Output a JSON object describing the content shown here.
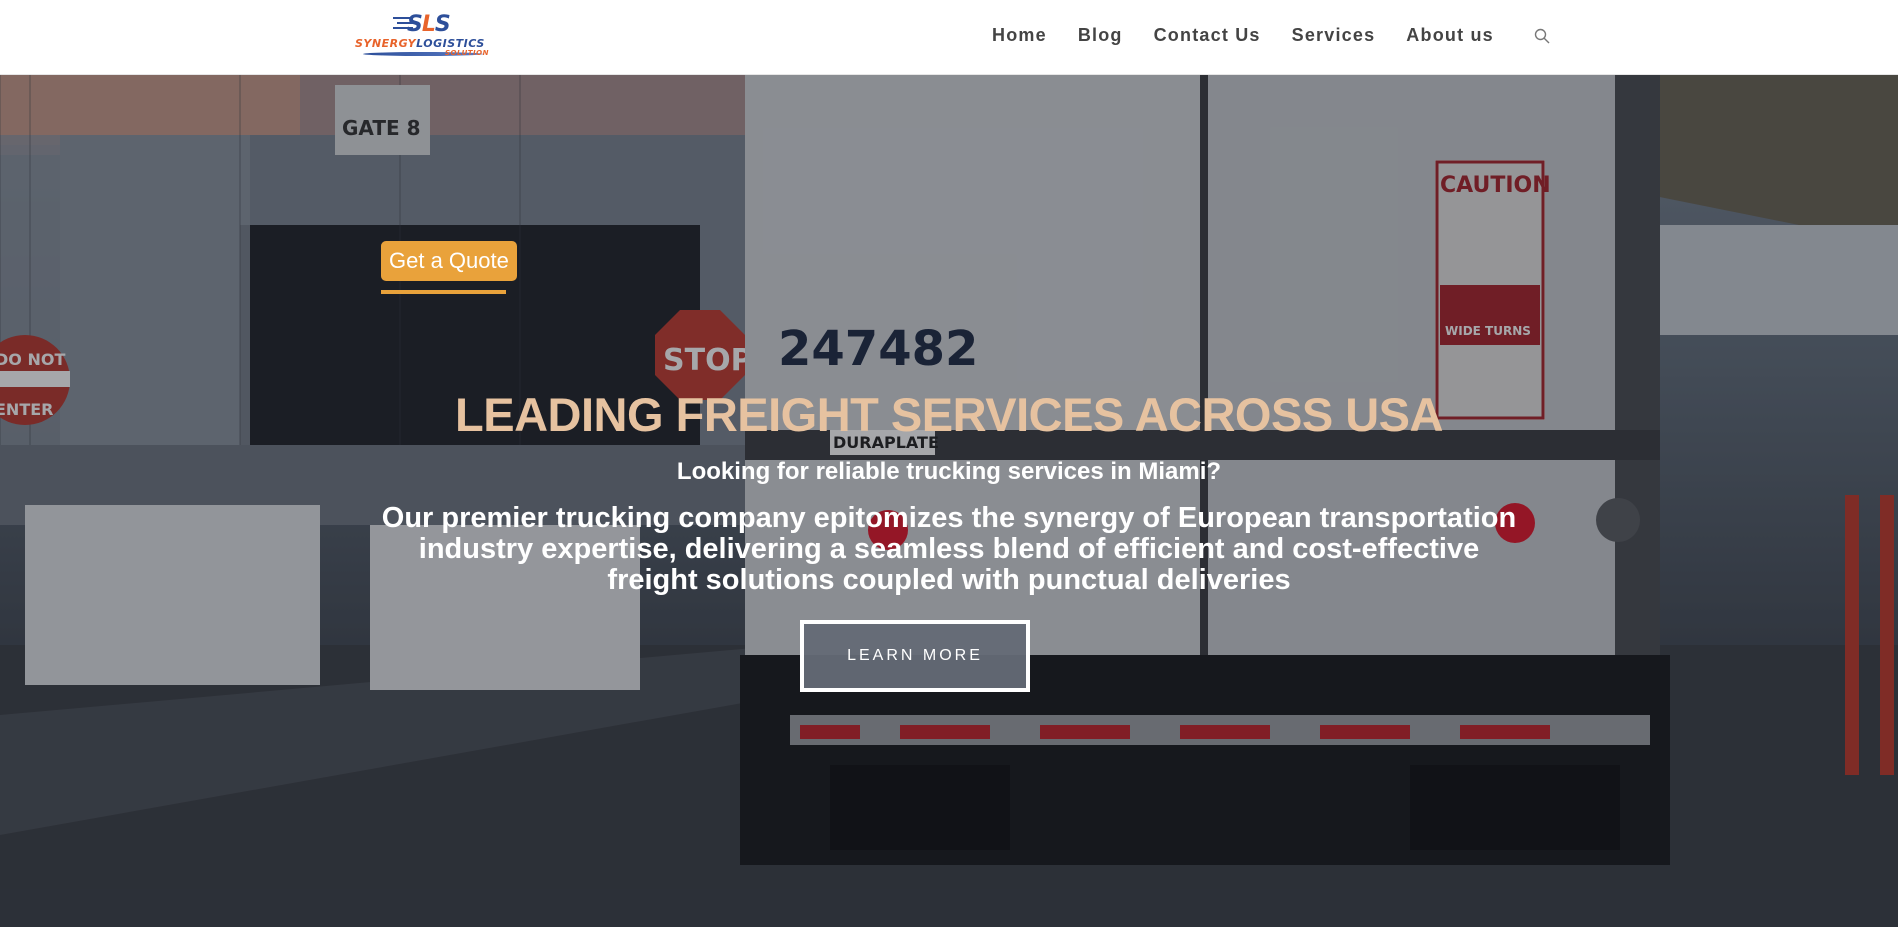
{
  "header": {
    "logo": {
      "mark": "SLS",
      "name_part1": "SYNERGY",
      "name_part2": "LOGISTICS",
      "tagline": "SOLUTION"
    },
    "nav": [
      {
        "label": "Home"
      },
      {
        "label": "Blog"
      },
      {
        "label": "Contact Us"
      },
      {
        "label": "Services"
      },
      {
        "label": "About us"
      }
    ],
    "search_icon": "search-icon"
  },
  "hero": {
    "quote_button": "Get a Quote",
    "title": "LEADING FREIGHT SERVICES ACROSS USA",
    "subtitle": "Looking for reliable trucking services in Miami?",
    "description": "Our premier trucking company epitomizes the synergy of European transportation industry expertise, delivering a seamless blend of efficient and cost-effective freight solutions coupled with punctual deliveries",
    "learn_more": "LEARN MORE",
    "background_signs": {
      "gate": "GATE 8",
      "truck_number": "247482",
      "stop": "STOP",
      "caution": "CAUTION",
      "wide_turns": "WIDE TURNS",
      "trailer_brand": "DURAPLATE",
      "do_not_enter_1": "DO NOT",
      "do_not_enter_2": "ENTER"
    }
  },
  "colors": {
    "accent": "#e9a23b",
    "title": "#e6c2a0",
    "nav_text": "#444444",
    "logo_blue": "#2d4f9a",
    "logo_orange": "#e8632b"
  }
}
